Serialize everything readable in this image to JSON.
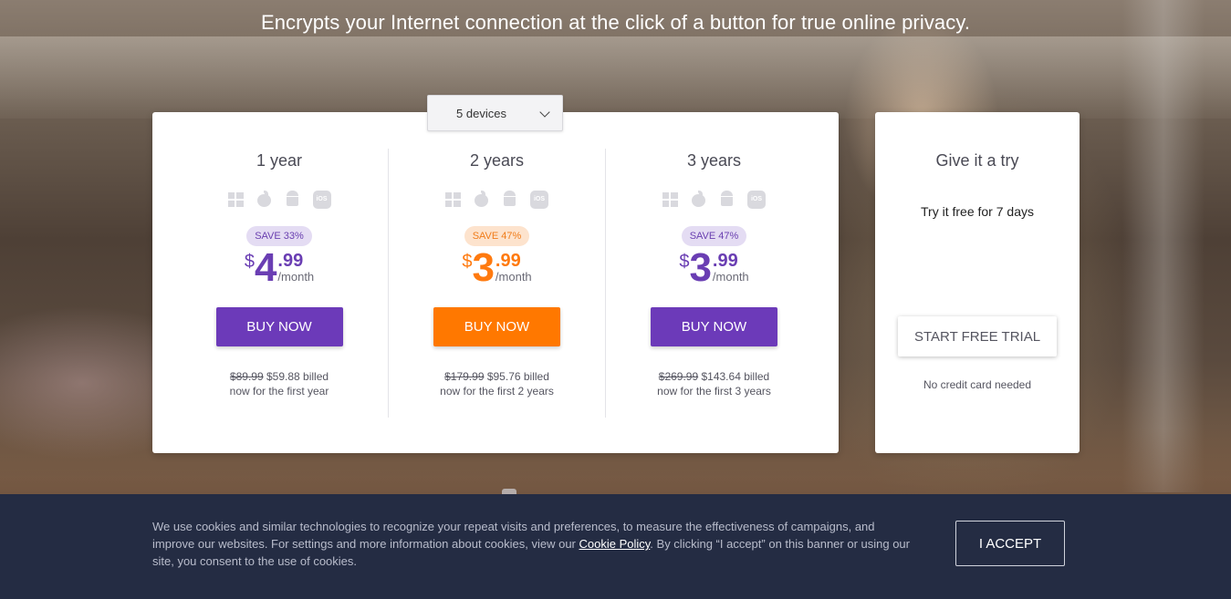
{
  "hero": {
    "headline": "Encrypts your Internet connection at the click of a button for true online privacy."
  },
  "devices_select": {
    "value": "5 devices"
  },
  "plans": [
    {
      "title": "1 year",
      "badge": "SAVE 33%",
      "currency": "$",
      "price_int": "4",
      "price_dec": ".99",
      "per": "/month",
      "button": "BUY NOW",
      "old_price": "$89.99",
      "billed_line1": " $59.88 billed",
      "billed_line2": "now for the first year",
      "accent": "#6c3ab9"
    },
    {
      "title": "2 years",
      "badge": "SAVE 47%",
      "currency": "$",
      "price_int": "3",
      "price_dec": ".99",
      "per": "/month",
      "button": "BUY NOW",
      "old_price": "$179.99",
      "billed_line1": " $95.76 billed",
      "billed_line2": "now for the first 2 years",
      "accent": "#ff7800"
    },
    {
      "title": "3 years",
      "badge": "SAVE 47%",
      "currency": "$",
      "price_int": "3",
      "price_dec": ".99",
      "per": "/month",
      "button": "BUY NOW",
      "old_price": "$269.99",
      "billed_line1": " $143.64 billed",
      "billed_line2": "now for the first 3 years",
      "accent": "#6c3ab9"
    }
  ],
  "os_icons": [
    "windows-icon",
    "apple-icon",
    "android-icon",
    "ios-icon"
  ],
  "os_ios_label": "iOS",
  "trial": {
    "title": "Give it a try",
    "subtitle": "Try it free for 7 days",
    "button": "START FREE TRIAL",
    "note": "No credit card needed"
  },
  "cookie": {
    "text_before": "We use cookies and similar technologies to recognize your repeat visits and preferences, to measure the effectiveness of campaigns, and improve our websites. For settings and more information about cookies, view our ",
    "link": "Cookie Policy",
    "text_after": ". By clicking “I accept” on this banner or using our site, you consent to the use of cookies.",
    "accept": "I ACCEPT"
  },
  "colors": {
    "purple": "#6c3ab9",
    "orange": "#ff7800",
    "cookie_bg": "#242c43"
  }
}
